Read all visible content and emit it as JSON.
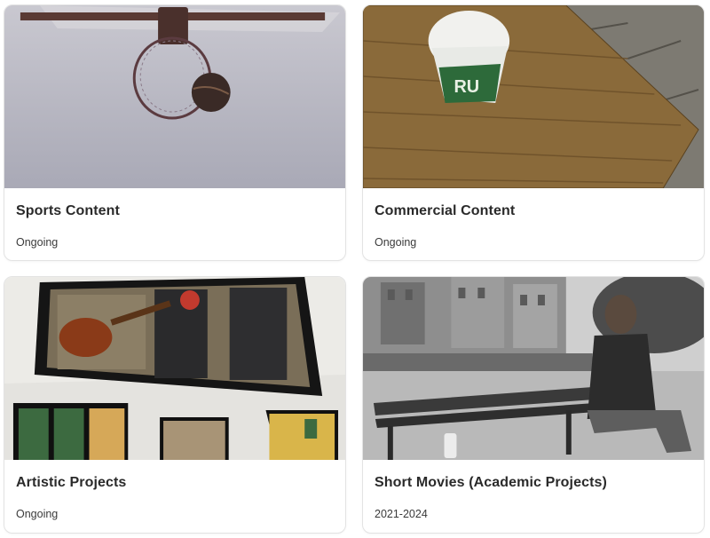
{
  "cards": [
    {
      "title": "Sports Content",
      "status": "Ongoing",
      "image": "basketball-hoop-photo"
    },
    {
      "title": "Commercial Content",
      "status": "Ongoing",
      "image": "paper-cup-on-wood-photo"
    },
    {
      "title": "Artistic Projects",
      "status": "Ongoing",
      "image": "musicians-collage-photo"
    },
    {
      "title": "Short Movies (Academic Projects)",
      "status": "2021-2024",
      "image": "man-on-bench-photo"
    }
  ]
}
